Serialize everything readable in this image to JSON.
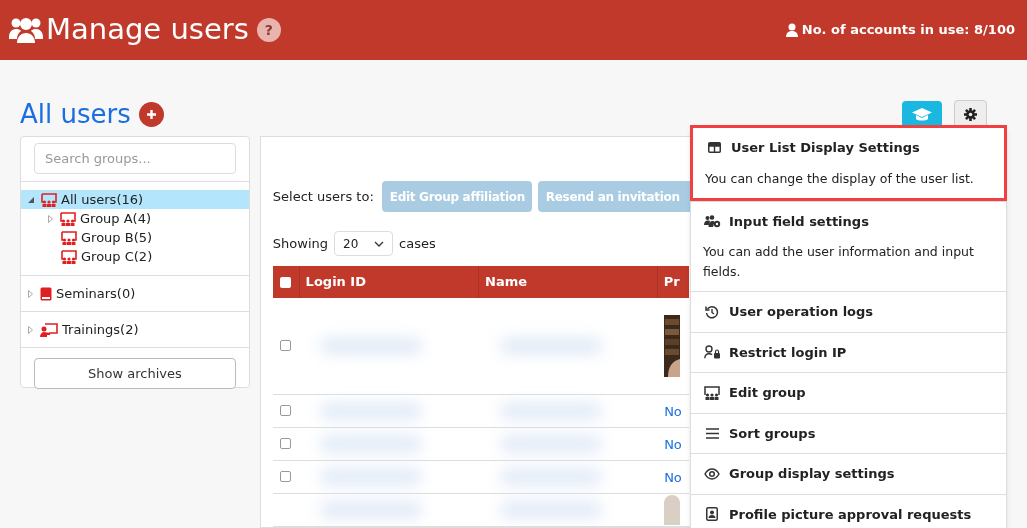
{
  "header": {
    "title": "Manage users",
    "help": "?",
    "accounts": "No. of accounts in use: 8/100"
  },
  "page_title": "All users",
  "sidebar": {
    "search": {
      "placeholder": "Search groups..."
    },
    "sections": [
      {
        "label": "All users(16)",
        "kind": "group",
        "expanded": true,
        "selected": true,
        "children": [
          {
            "label": "Group A(4)",
            "kind": "group",
            "expanded": false,
            "selected": false
          },
          {
            "label": "Group B(5)",
            "kind": "group",
            "selected": false
          },
          {
            "label": "Group C(2)",
            "kind": "group",
            "selected": false
          }
        ]
      },
      {
        "label": "Seminars(0)",
        "kind": "seminar",
        "expanded": false,
        "selected": false
      },
      {
        "label": "Trainings(2)",
        "kind": "training",
        "expanded": false,
        "selected": false
      }
    ],
    "archive_button": "Show archives"
  },
  "toolbar": {
    "label": "Select users to:",
    "buttons": [
      {
        "label": "Edit Group affiliation",
        "disabled": true
      },
      {
        "label": "Resend an invitation",
        "disabled": true
      }
    ]
  },
  "paging": {
    "label": "Showing",
    "value": "20",
    "suffix": "cases"
  },
  "table": {
    "all_checked": false,
    "columns": [
      "Login ID",
      "Name",
      "Pr"
    ],
    "rows": [
      {
        "checked": false,
        "kind": "picture"
      },
      {
        "checked": false,
        "kind": "text",
        "column_3": "No"
      },
      {
        "checked": false,
        "kind": "text",
        "column_3": "No"
      },
      {
        "checked": false,
        "kind": "text",
        "column_3": "No"
      },
      {
        "kind": "picture"
      }
    ]
  },
  "menu": {
    "items": [
      {
        "title": "User List Display Settings",
        "description": "You can change the display of the user list.",
        "highlighted": true
      },
      {
        "title": "Input field settings",
        "description": "You can add the user information and input fields.",
        "highlighted": false
      },
      {
        "title": "User operation logs",
        "highlighted": false
      },
      {
        "title": "Restrict login IP",
        "highlighted": false
      },
      {
        "title": "Edit group",
        "highlighted": false
      },
      {
        "title": "Sort groups",
        "highlighted": false
      },
      {
        "title": "Group display settings",
        "highlighted": false
      },
      {
        "title": "Profile picture approval requests",
        "highlighted": false
      }
    ]
  }
}
